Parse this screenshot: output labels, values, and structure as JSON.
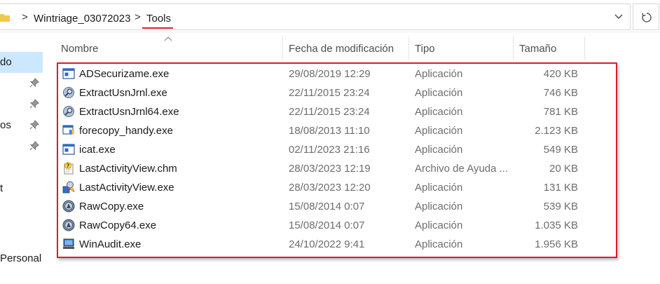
{
  "address_bar": {
    "crumbs": [
      "Wintriage_03072023",
      "Tools"
    ],
    "separator": ">"
  },
  "nav_pane": {
    "items": [
      {
        "label": "do",
        "selected": true
      },
      {
        "label": "",
        "pinned": true
      },
      {
        "label": "",
        "pinned": true
      },
      {
        "label": "os",
        "pinned": true
      },
      {
        "label": "",
        "pinned": true
      },
      {
        "label": "t"
      },
      {
        "label": "Personal"
      }
    ]
  },
  "columns": {
    "name": "Nombre",
    "date": "Fecha de modificación",
    "type": "Tipo",
    "size": "Tamaño"
  },
  "files": [
    {
      "name": "ADSecurizame.exe",
      "date": "29/08/2019 12:29",
      "type": "Aplicación",
      "size": "420 KB",
      "icon": "window-app-icon"
    },
    {
      "name": "ExtractUsnJrnl.exe",
      "date": "22/11/2015 23:24",
      "type": "Aplicación",
      "size": "746 KB",
      "icon": "magnifier-disk-icon"
    },
    {
      "name": "ExtractUsnJrnl64.exe",
      "date": "22/11/2015 23:24",
      "type": "Aplicación",
      "size": "781 KB",
      "icon": "magnifier-disk-icon"
    },
    {
      "name": "forecopy_handy.exe",
      "date": "18/08/2013 11:10",
      "type": "Aplicación",
      "size": "2.123 KB",
      "icon": "shield-app-icon"
    },
    {
      "name": "icat.exe",
      "date": "02/11/2023 21:16",
      "type": "Aplicación",
      "size": "549 KB",
      "icon": "window-app-icon"
    },
    {
      "name": "LastActivityView.chm",
      "date": "28/03/2023 12:19",
      "type": "Archivo de Ayuda ...",
      "size": "20 KB",
      "icon": "help-file-icon"
    },
    {
      "name": "LastActivityView.exe",
      "date": "28/03/2023 12:20",
      "type": "Aplicación",
      "size": "131 KB",
      "icon": "activity-view-icon"
    },
    {
      "name": "RawCopy.exe",
      "date": "15/08/2014 0:07",
      "type": "Aplicación",
      "size": "539 KB",
      "icon": "disc-app-icon"
    },
    {
      "name": "RawCopy64.exe",
      "date": "15/08/2014 0:07",
      "type": "Aplicación",
      "size": "1.035 KB",
      "icon": "disc-app-icon"
    },
    {
      "name": "WinAudit.exe",
      "date": "24/10/2022 9:41",
      "type": "Aplicación",
      "size": "1.956 KB",
      "icon": "computer-app-icon"
    }
  ],
  "colors": {
    "highlight": "#d5202b",
    "selection": "#cce8ff"
  }
}
